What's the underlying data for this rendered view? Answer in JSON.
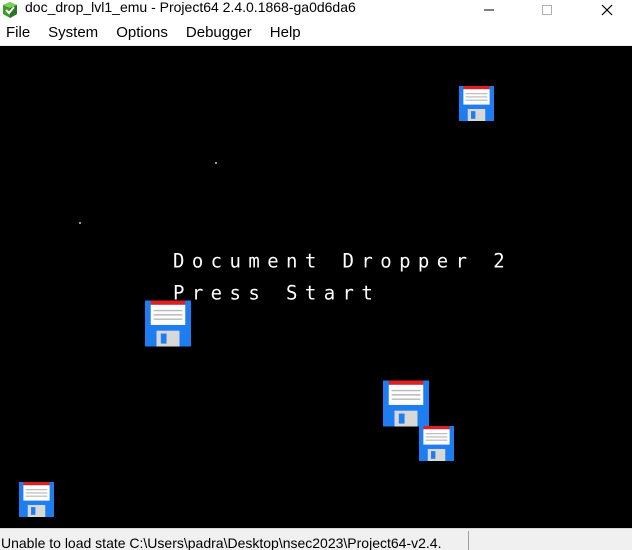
{
  "window": {
    "title": "doc_drop_lvl1_emu - Project64 2.4.0.1868-ga0d6da6",
    "buttons": {
      "minimize": "—",
      "maximize": "☐",
      "close": "✕"
    }
  },
  "menu": {
    "items": [
      "File",
      "System",
      "Options",
      "Debugger",
      "Help"
    ]
  },
  "game": {
    "title": "Document Dropper 2",
    "prompt": "Press Start"
  },
  "status": {
    "message": "Unable to load state C:\\Users\\padra\\Desktop\\nsec2023\\Project64-v2.4."
  },
  "colors": {
    "screen_bg": "#000000",
    "floppy_body": "#1e7df0",
    "floppy_label_top": "#e02020",
    "floppy_label": "#ffffff"
  },
  "icons": {
    "app": "project64-icon",
    "sprite": "floppy-disk-icon"
  }
}
